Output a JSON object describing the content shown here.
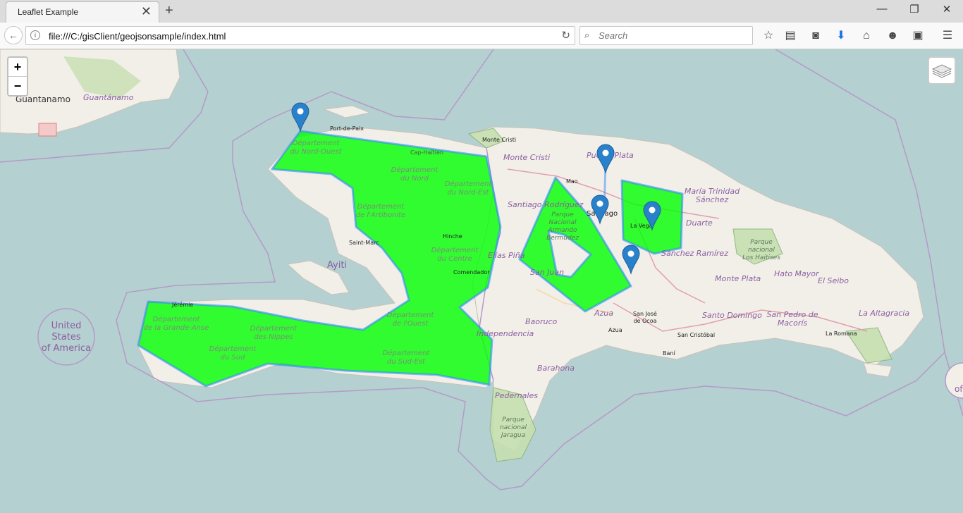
{
  "tab": {
    "title": "Leaflet Example"
  },
  "window": {
    "minimize": "—",
    "restore": "❐",
    "close": "✕",
    "new_tab": "+",
    "tab_close": "✕"
  },
  "address": {
    "url": "file:///C:/gisClient/geojsonsample/index.html"
  },
  "search": {
    "placeholder": "Search"
  },
  "map": {
    "zoom_in": "+",
    "zoom_out": "−",
    "polygon_color": "#00ff00",
    "polygon_stroke": "#3388ff",
    "labels": {
      "guantanamo": "Guantanamo",
      "guantanamo_region": "Guantánamo",
      "us_1": "United",
      "us_2": "States",
      "us_3": "of America",
      "ayiti": "Ayiti",
      "port_de_paix": "Port-de-Paix",
      "monte_cristi_town": "Monte Cristi",
      "monte_cristi": "Monte Cristi",
      "cap_haitien": "Cap-Haïtien",
      "dept_nord_ouest_1": "Département",
      "dept_nord_ouest_2": "du Nord-Ouest",
      "dept_nord_1": "Département",
      "dept_nord_2": "du Nord",
      "dept_nord_est_1": "Département",
      "dept_nord_est_2": "du Nord-Est",
      "dept_artibonite_1": "Département",
      "dept_artibonite_2": "de l'Artibonite",
      "hinche": "Hinche",
      "saint_marc": "Saint-Marc",
      "dept_centre_1": "Département",
      "dept_centre_2": "du Centre",
      "comendador": "Comendador",
      "elias_pina": "Elías Piña",
      "jeremie": "Jérémie",
      "dept_grande_anse_1": "Département",
      "dept_grande_anse_2": "de la Grande-Anse",
      "dept_nippes_1": "Département",
      "dept_nippes_2": "des Nippes",
      "dept_ouest_1": "Département",
      "dept_ouest_2": "de l'Ouest",
      "dept_sud_1": "Département",
      "dept_sud_2": "du Sud",
      "dept_sud_est_1": "Département",
      "dept_sud_est_2": "du Sud-Est",
      "santiago_rodriguez": "Santiago Rodríguez",
      "parque_armando_1": "Parque",
      "parque_armando_2": "Nacional",
      "parque_armando_3": "Armando",
      "parque_armando_4": "Bermúdez",
      "mao": "Mao",
      "santiago": "Santiago",
      "puerto_plata": "Puerto Plata",
      "la_vega": "La Vega",
      "maria_trinidad_1": "María Trinidad",
      "maria_trinidad_2": "Sánchez",
      "duarte": "Duarte",
      "sanchez_ramirez": "Sánchez Ramírez",
      "parque_haitises_1": "Parque",
      "parque_haitises_2": "nacional",
      "parque_haitises_3": "Los Haitises",
      "hato_mayor": "Hato Mayor",
      "el_seibo": "El Seibo",
      "monte_plata": "Monte Plata",
      "san_juan": "San Juan",
      "azua_region": "Azua",
      "azua": "Azua",
      "san_jose_1": "San José",
      "san_jose_2": "de Ocoa",
      "baoruco": "Baoruco",
      "independencia": "Independencia",
      "barahona": "Barahona",
      "santo_domingo": "Santo Domingo",
      "san_pedro_1": "San Pedro de",
      "san_pedro_2": "Macorís",
      "la_altagracia": "La Altagracia",
      "la_romana": "La Romana",
      "san_cristobal": "San Cristóbal",
      "bani": "Baní",
      "pedernales": "Pedernales",
      "parque_jaragua_1": "Parque",
      "parque_jaragua_2": "nacional",
      "parque_jaragua_3": "Jaragua",
      "edge_of": "of"
    }
  }
}
